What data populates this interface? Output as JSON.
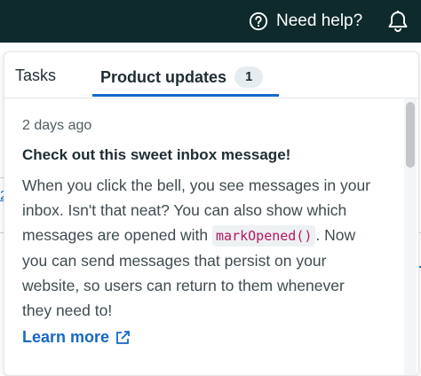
{
  "header": {
    "help_label": "Need help?"
  },
  "background": {
    "number": "2"
  },
  "tabs": [
    {
      "label": "Tasks"
    },
    {
      "label": "Product updates",
      "count": "1"
    }
  ],
  "message": {
    "time": "2 days ago",
    "title": "Check out this sweet inbox message!",
    "body_before": "When you click the bell, you see messages in your inbox. Isn't that neat? You can also show which messages are opened with ",
    "code": "markOpened()",
    "body_after": ". Now you can send messages that persist on your website, so users can return to them whenever they need to!",
    "link": "Learn more"
  },
  "colors": {
    "topbar": "#0e2a2c",
    "accent": "#1668c8",
    "code": "#b5175f"
  },
  "icons": [
    "question-circle-icon",
    "bell-icon",
    "external-link-icon"
  ]
}
